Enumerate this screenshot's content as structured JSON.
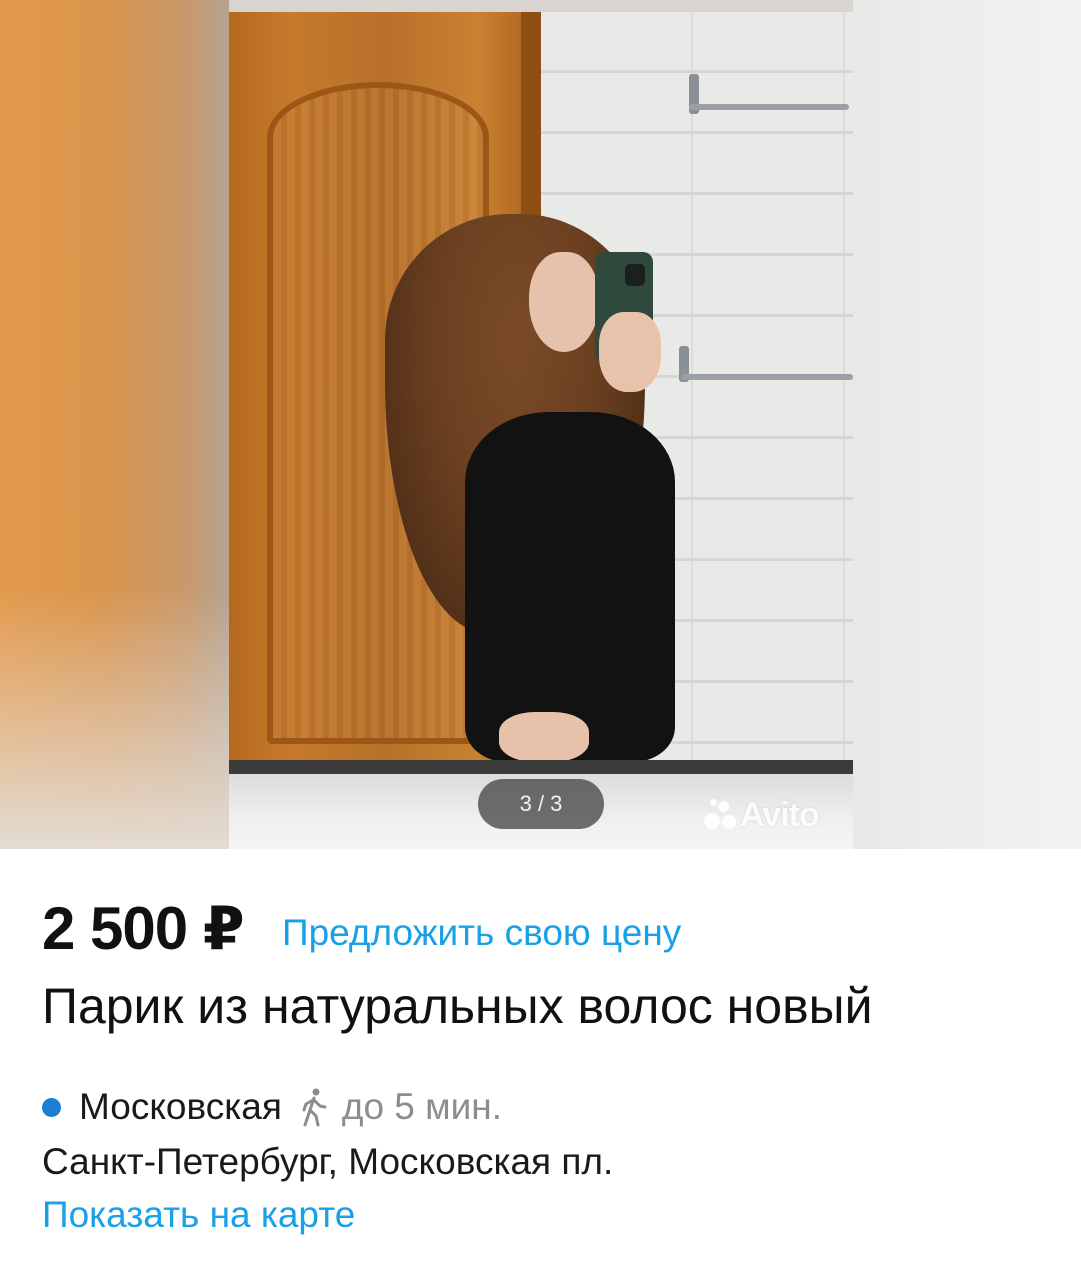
{
  "gallery": {
    "counter_text": "3 / 3",
    "watermark_text": "Avito",
    "current_index": 3,
    "total": 3
  },
  "listing": {
    "price": "2 500 ₽",
    "offer_link": "Предложить свою цену",
    "title": "Парик из натуральных волос новый"
  },
  "location": {
    "metro_station": "Московская",
    "metro_line_color": "#1c7fd6",
    "walk_icon": "walking-person-icon",
    "walk_time": "до 5 мин.",
    "address": "Санкт-Петербург, Московская пл.",
    "map_link": "Показать на карте"
  },
  "colors": {
    "link": "#1aa0e6",
    "text": "#111111",
    "muted": "#8d8d8d"
  }
}
